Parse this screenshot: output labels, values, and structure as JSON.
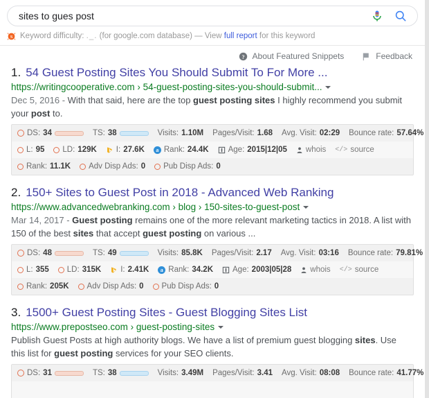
{
  "search": {
    "query": "sites to gues post",
    "placeholder": "Search",
    "mic_icon": "microphone-icon",
    "search_icon": "search-icon"
  },
  "keyword_difficulty": {
    "logo_icon": "seoquake-logo-icon",
    "label": "Keyword difficulty:",
    "loading_dots": "._.",
    "database": "(for google.com database)",
    "dash": "—",
    "view_text": "View",
    "link_text": "full report",
    "tail_text": "for this keyword"
  },
  "snippet_meta": {
    "about_icon": "question-mark-icon",
    "about_label": "About Featured Snippets",
    "feedback_icon": "flag-icon",
    "feedback_label": "Feedback"
  },
  "results": [
    {
      "number": "1.",
      "title": "54 Guest Posting Sites You Should Submit To For More ...",
      "url": "https://writingcooperative.com › 54-guest-posting-sites-you-should-submit...",
      "snippet_date": "Dec 5, 2016 - ",
      "snippet_pre": "With that said, here are the top ",
      "snippet_bold": "guest posting sites",
      "snippet_post": " I highly recommend you submit your ",
      "snippet_bold2": "post",
      "snippet_end": " to.",
      "metrics": {
        "row1": {
          "ds_label": "DS:",
          "ds_value": "34",
          "ds_pct": 34,
          "ts_label": "TS:",
          "ts_value": "38",
          "ts_pct": 38,
          "visits_label": "Visits:",
          "visits_value": "1.10M",
          "pages_label": "Pages/Visit:",
          "pages_value": "1.68",
          "avg_label": "Avg. Visit:",
          "avg_value": "02:29",
          "bounce_label": "Bounce rate:",
          "bounce_value": "57.64%",
          "info_icon": "info-icon"
        },
        "row2": {
          "l_label": "L:",
          "l_value": "95",
          "ld_label": "LD:",
          "ld_value": "129K",
          "i_label": "I:",
          "i_value": "27.6K",
          "rank_label": "Rank:",
          "rank_value": "24.4K",
          "age_label": "Age:",
          "age_value": "2015|12|05",
          "whois_label": "whois",
          "source_label": "source"
        },
        "row3": {
          "rank_label": "Rank:",
          "rank_value": "11.1K",
          "adv_label": "Adv Disp Ads:",
          "adv_value": "0",
          "pub_label": "Pub Disp Ads:",
          "pub_value": "0"
        }
      }
    },
    {
      "number": "2.",
      "title": "150+ Sites to Guest Post in 2018 - Advanced Web Ranking",
      "url": "https://www.advancedwebranking.com › blog › 150-sites-to-guest-post",
      "snippet_date": "Mar 14, 2017 - ",
      "snippet_pre": "",
      "snippet_bold": "Guest posting",
      "snippet_post": " remains one of the more relevant marketing tactics in 2018. A list with 150 of the best ",
      "snippet_bold2": "sites",
      "snippet_end": " that accept ",
      "snippet_bold3": "guest posting",
      "snippet_end2": " on various ...",
      "metrics": {
        "row1": {
          "ds_label": "DS:",
          "ds_value": "48",
          "ds_pct": 48,
          "ts_label": "TS:",
          "ts_value": "49",
          "ts_pct": 49,
          "visits_label": "Visits:",
          "visits_value": "85.8K",
          "pages_label": "Pages/Visit:",
          "pages_value": "2.17",
          "avg_label": "Avg. Visit:",
          "avg_value": "03:16",
          "bounce_label": "Bounce rate:",
          "bounce_value": "79.81%",
          "info_icon": "info-icon"
        },
        "row2": {
          "l_label": "L:",
          "l_value": "355",
          "ld_label": "LD:",
          "ld_value": "315K",
          "i_label": "I:",
          "i_value": "2.41K",
          "rank_label": "Rank:",
          "rank_value": "34.2K",
          "age_label": "Age:",
          "age_value": "2003|05|28",
          "whois_label": "whois",
          "source_label": "source"
        },
        "row3": {
          "rank_label": "Rank:",
          "rank_value": "205K",
          "adv_label": "Adv Disp Ads:",
          "adv_value": "0",
          "pub_label": "Pub Disp Ads:",
          "pub_value": "0"
        }
      }
    },
    {
      "number": "3.",
      "title": "1500+ Guest Posting Sites - Guest Blogging Sites List",
      "url": "https://www.prepostseo.com › guest-posting-sites",
      "snippet_date": "",
      "snippet_pre": "Publish Guest Posts at high authority blogs. We have a list of premium guest blogging ",
      "snippet_bold": "sites",
      "snippet_post": ". Use this list for ",
      "snippet_bold2": "guest posting",
      "snippet_end": " services for your SEO clients.",
      "metrics": {
        "row1": {
          "ds_label": "DS:",
          "ds_value": "31",
          "ds_pct": 31,
          "ts_label": "TS:",
          "ts_value": "38",
          "ts_pct": 38,
          "visits_label": "Visits:",
          "visits_value": "3.49M",
          "pages_label": "Pages/Visit:",
          "pages_value": "3.41",
          "avg_label": "Avg. Visit:",
          "avg_value": "08:08",
          "bounce_label": "Bounce rate:",
          "bounce_value": "41.77%",
          "info_icon": "info-icon"
        }
      }
    }
  ],
  "colors": {
    "link": "#4240a5",
    "url_green": "#0b7c22",
    "kd_link": "#3c5bdb",
    "ds_bar": "#c0391b",
    "ts_bar": "#29a3dd",
    "metrics_bg": "#f1f1f1"
  }
}
